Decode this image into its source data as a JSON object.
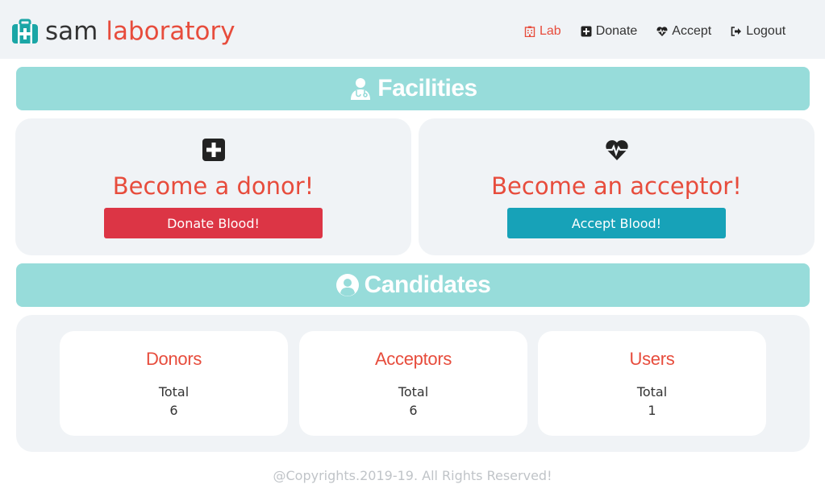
{
  "brand": {
    "first": "sam",
    "second": "laboratory"
  },
  "nav": {
    "lab": "Lab",
    "donate": "Donate",
    "accept": "Accept",
    "logout": "Logout"
  },
  "facilities": {
    "title": "Facilities",
    "donor": {
      "title": "Become a donor!",
      "button": "Donate Blood!"
    },
    "acceptor": {
      "title": "Become an acceptor!",
      "button": "Accept Blood!"
    }
  },
  "candidates": {
    "title": "Candidates",
    "items": [
      {
        "title": "Donors",
        "label": "Total",
        "value": "6"
      },
      {
        "title": "Acceptors",
        "label": "Total",
        "value": "6"
      },
      {
        "title": "Users",
        "label": "Total",
        "value": "1"
      }
    ]
  },
  "footer": "@Copyrights.2019-19. All Rights Reserved!",
  "colors": {
    "accent": "#e74c3c",
    "teal": "#97dcda",
    "danger": "#dc3545",
    "info": "#17a2b8",
    "panel": "#f0f3f6"
  }
}
